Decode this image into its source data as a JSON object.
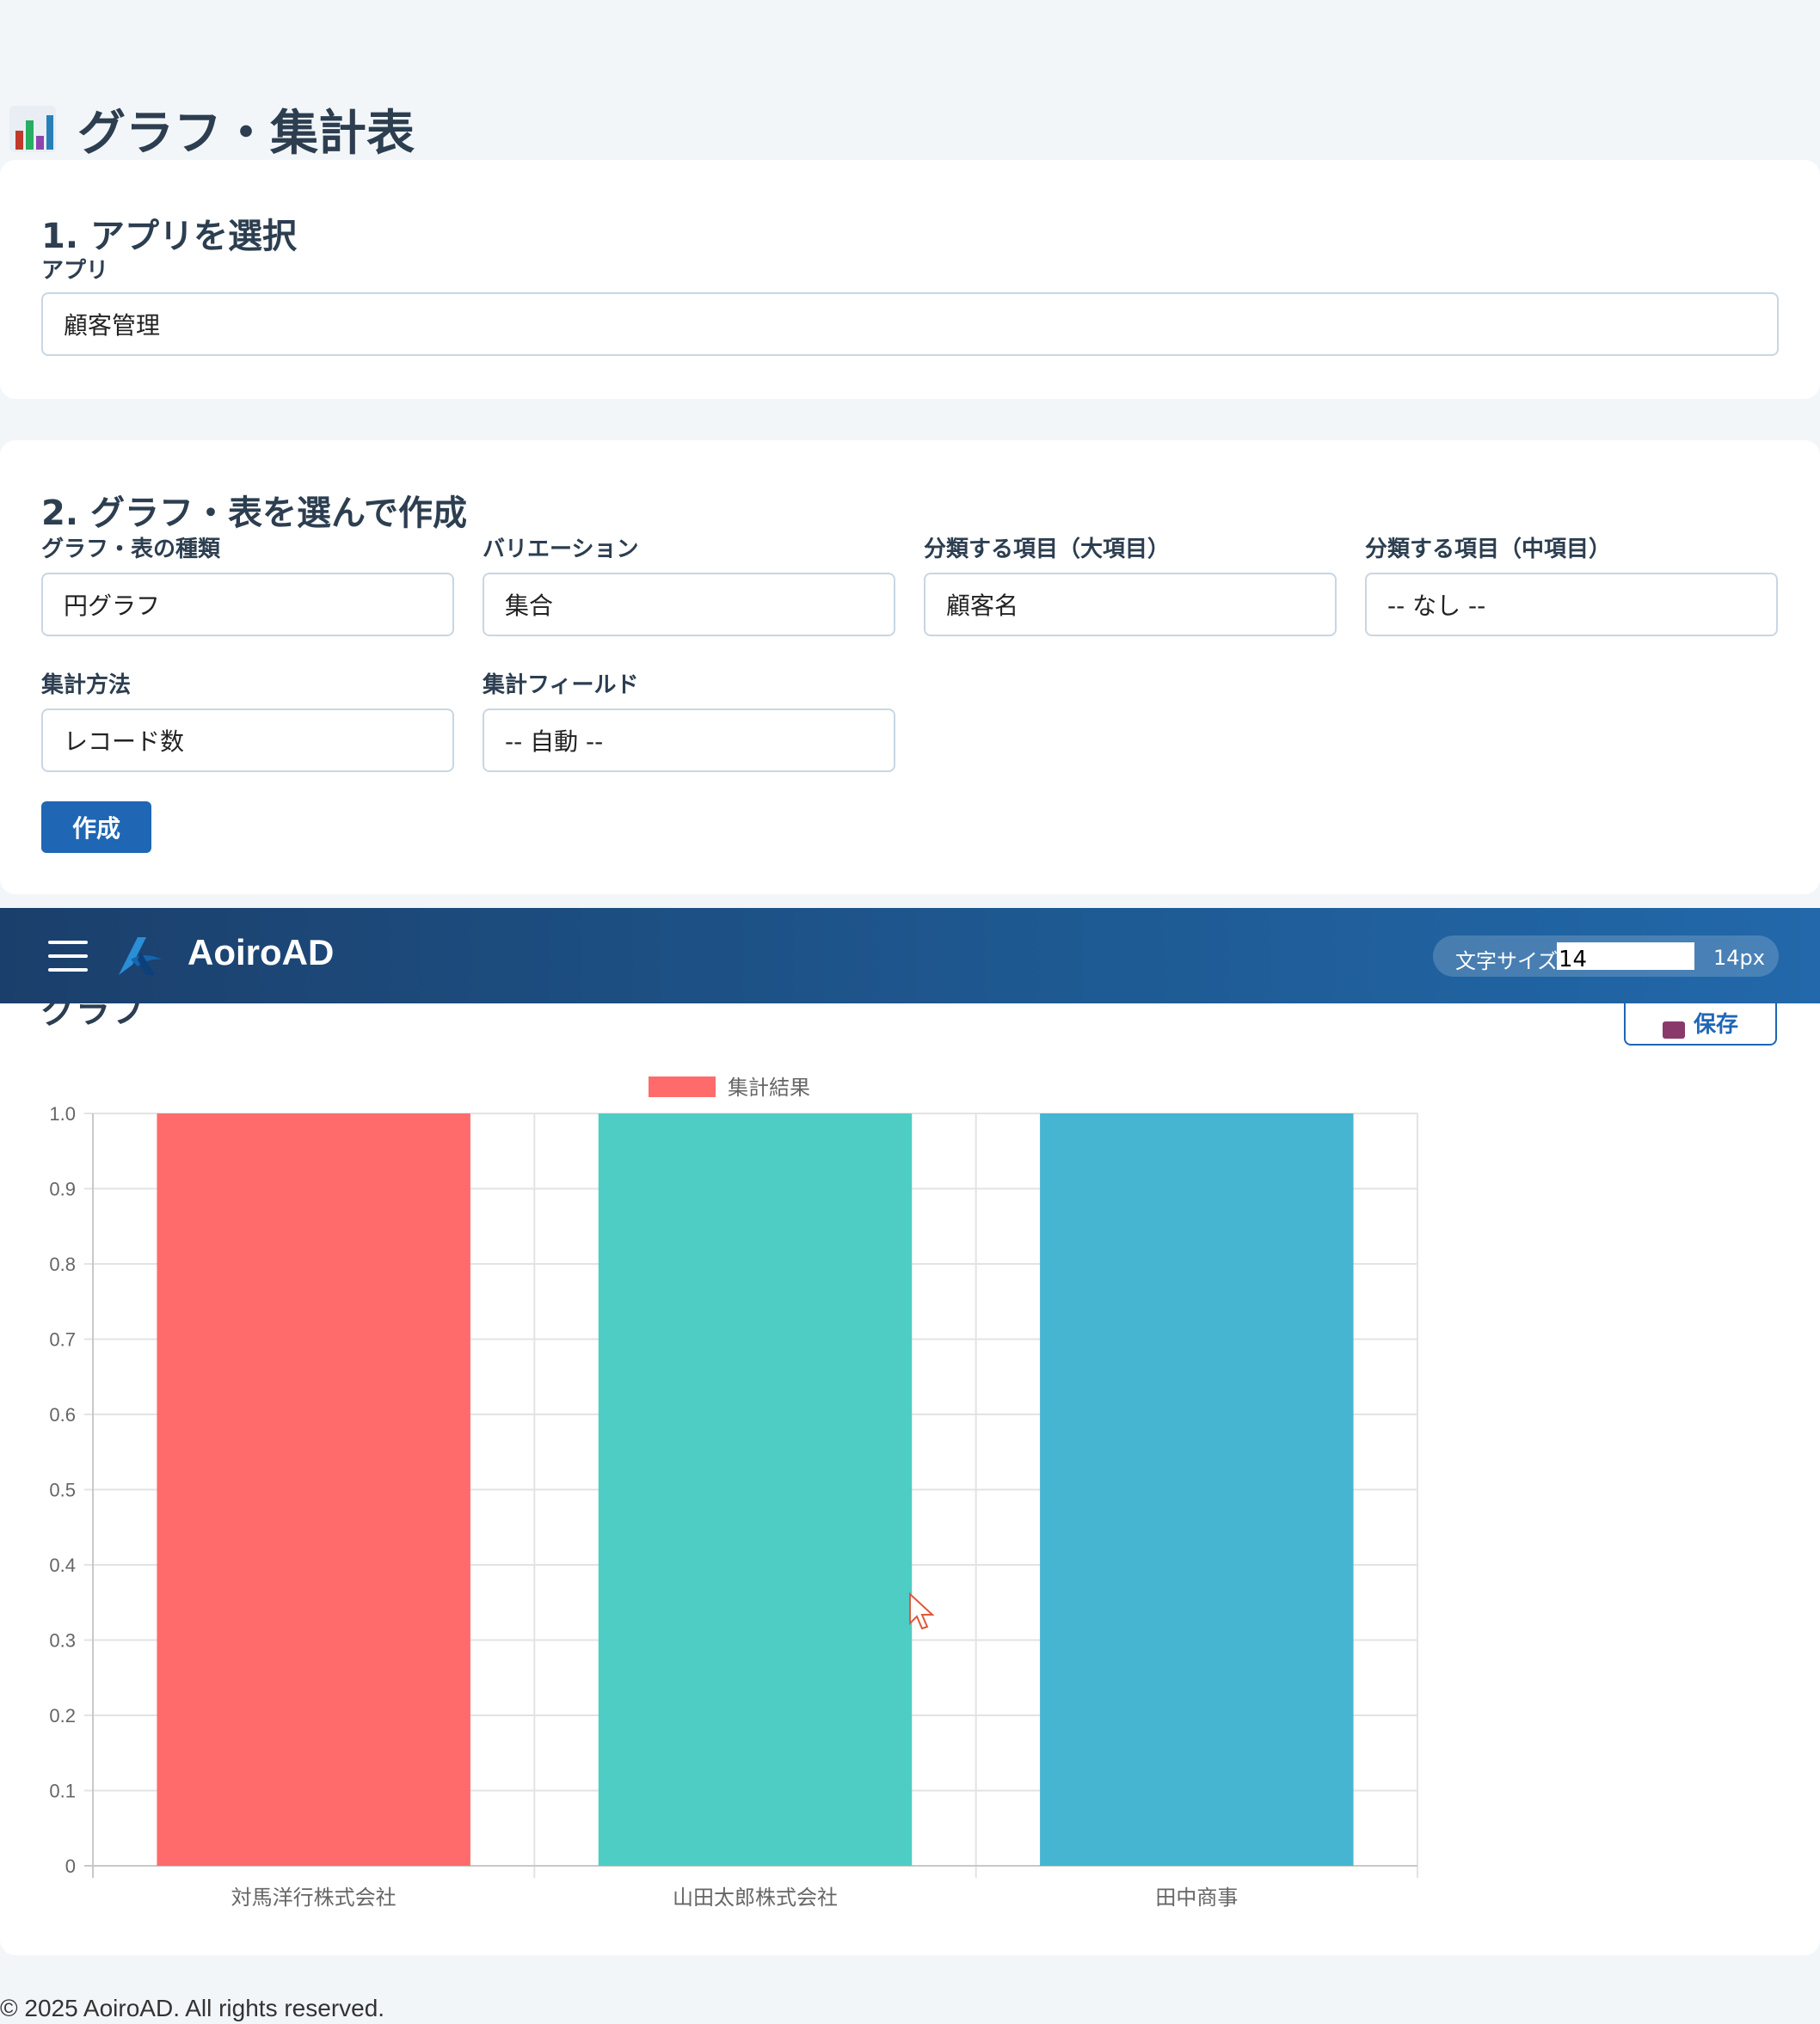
{
  "page": {
    "title": "グラフ・集計表",
    "title_icon": "bar-chart-icon"
  },
  "section1": {
    "title": "1. アプリを選択",
    "app_label": "アプリ",
    "app_value": "顧客管理"
  },
  "section2": {
    "title": "2. グラフ・表を選んで作成",
    "fields": {
      "chart_type": {
        "label": "グラフ・表の種類",
        "value": "円グラフ"
      },
      "variation": {
        "label": "バリエーション",
        "value": "集合"
      },
      "category_major": {
        "label": "分類する項目（大項目）",
        "value": "顧客名"
      },
      "category_minor": {
        "label": "分類する項目（中項目）",
        "value": "-- なし --"
      },
      "aggregation": {
        "label": "集計方法",
        "value": "レコード数"
      },
      "aggregation_field": {
        "label": "集計フィールド",
        "value": "-- 自動 --"
      }
    },
    "create_button": "作成"
  },
  "topbar": {
    "brand": "AoiroAD",
    "menu_icon": "hamburger-menu-icon",
    "logo_icon": "aoiro-logo-icon",
    "font_size_label": "文字サイズ",
    "font_size_input": "14",
    "font_size_value": "14px"
  },
  "graph_section": {
    "title": "グラフ",
    "save_button": "保存",
    "save_icon": "floppy-disk-icon"
  },
  "chart_data": {
    "type": "bar",
    "categories": [
      "対馬洋行株式会社",
      "山田太郎株式会社",
      "田中商事"
    ],
    "series": [
      {
        "name": "集計結果",
        "values": [
          1,
          1,
          1
        ]
      }
    ],
    "bar_colors": [
      "#ff6b6b",
      "#4ecdc4",
      "#45b5d2"
    ],
    "legend_color": "#ff6b6b",
    "ylim": [
      0,
      1.0
    ],
    "yticks": [
      "0",
      "0.1",
      "0.2",
      "0.3",
      "0.4",
      "0.5",
      "0.6",
      "0.7",
      "0.8",
      "0.9",
      "1.0"
    ],
    "grid": true,
    "legend": "top"
  },
  "footer": {
    "text": "© 2025 AoiroAD. All rights reserved."
  }
}
